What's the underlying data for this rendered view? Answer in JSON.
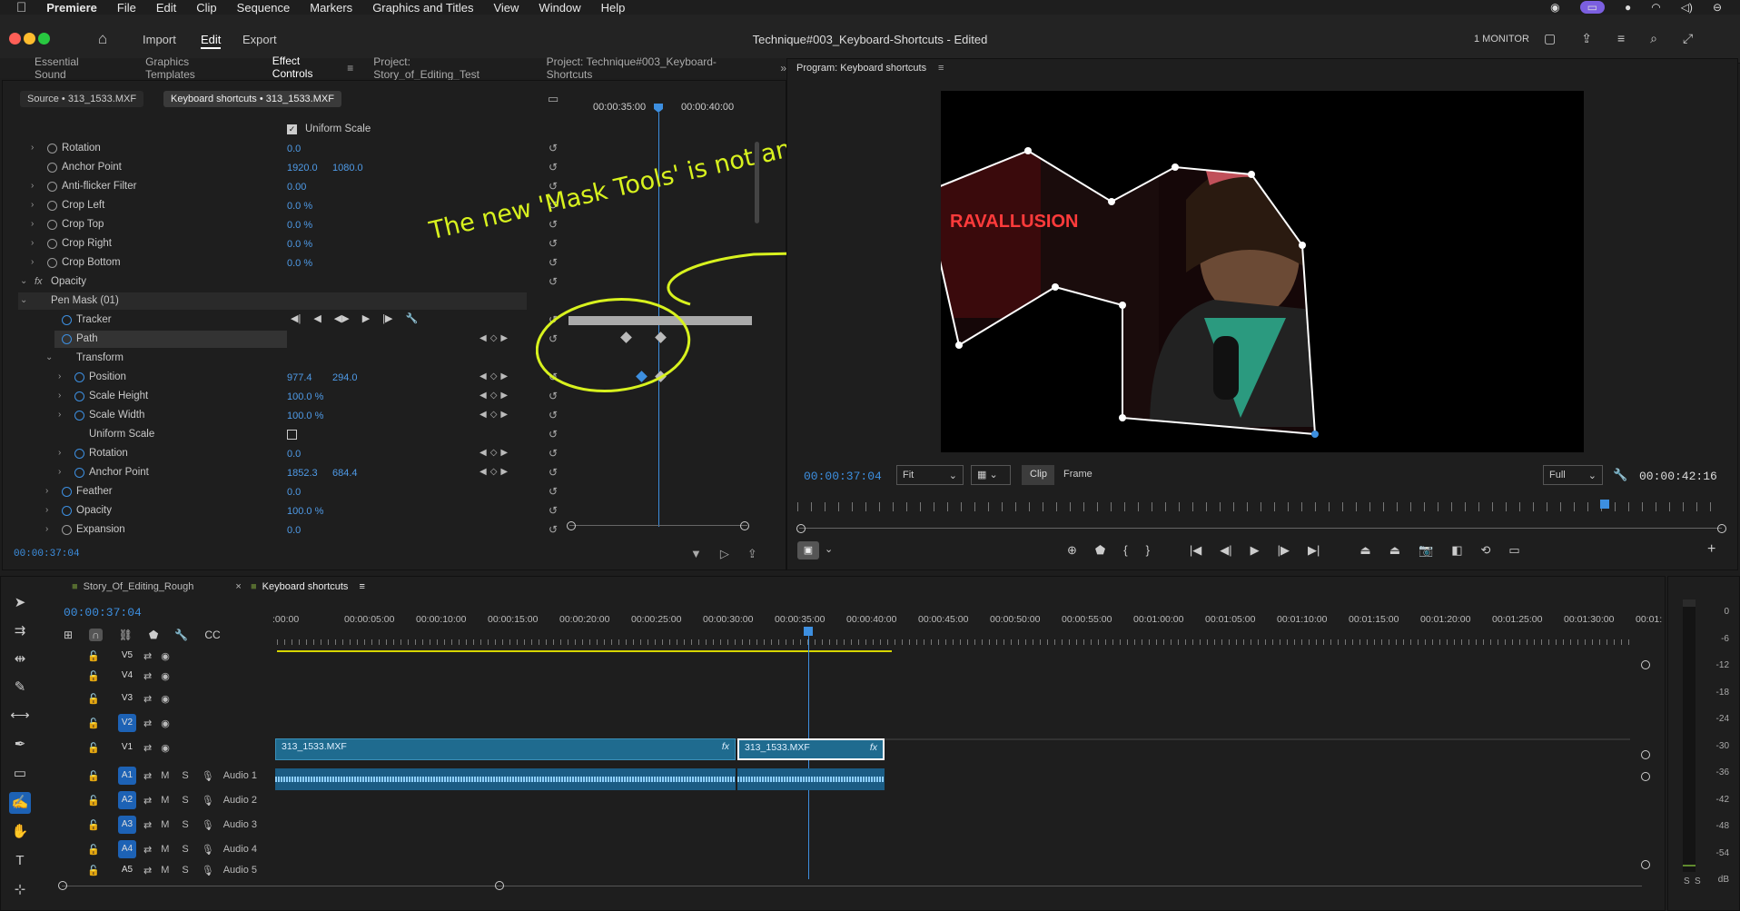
{
  "menu": {
    "apple": "",
    "app": "Premiere",
    "items": [
      "File",
      "Edit",
      "Clip",
      "Sequence",
      "Markers",
      "Graphics and Titles",
      "View",
      "Window",
      "Help"
    ]
  },
  "appbar": {
    "title": "Technique#003_Keyboard-Shortcuts - Edited",
    "nav": [
      "Import",
      "Edit",
      "Export"
    ],
    "monitor": "1 MONITOR"
  },
  "workspace_tabs": [
    "Essential Sound",
    "Graphics Templates",
    "Effect Controls",
    "Project: Story_of_Editing_Test",
    "Project: Technique#003_Keyboard-Shortcuts"
  ],
  "program_title": "Program: Keyboard shortcuts",
  "ec": {
    "source_tab": "Source • 313_1533.MXF",
    "seq_tab": "Keyboard shortcuts • 313_1533.MXF",
    "ruler": [
      "00:00:35:00",
      "00:00:40:00"
    ],
    "timecode": "00:00:37:04",
    "rows": [
      {
        "label": "Uniform Scale",
        "v1": "",
        "v2": ""
      },
      {
        "label": "Rotation",
        "v1": "0.0",
        "v2": ""
      },
      {
        "label": "Anchor Point",
        "v1": "1920.0",
        "v2": "1080.0"
      },
      {
        "label": "Anti-flicker Filter",
        "v1": "0.00",
        "v2": ""
      },
      {
        "label": "Crop Left",
        "v1": "0.0 %",
        "v2": ""
      },
      {
        "label": "Crop Top",
        "v1": "0.0 %",
        "v2": ""
      },
      {
        "label": "Crop Right",
        "v1": "0.0 %",
        "v2": ""
      },
      {
        "label": "Crop Bottom",
        "v1": "0.0 %",
        "v2": ""
      },
      {
        "label": "Opacity",
        "v1": "",
        "v2": ""
      },
      {
        "label": "Pen Mask (01)",
        "v1": "",
        "v2": ""
      },
      {
        "label": "Tracker",
        "v1": "",
        "v2": ""
      },
      {
        "label": "Path",
        "v1": "",
        "v2": ""
      },
      {
        "label": "Transform",
        "v1": "",
        "v2": ""
      },
      {
        "label": "Position",
        "v1": "977.4",
        "v2": "294.0"
      },
      {
        "label": "Scale Height",
        "v1": "100.0 %",
        "v2": ""
      },
      {
        "label": "Scale Width",
        "v1": "100.0 %",
        "v2": ""
      },
      {
        "label": "Uniform Scale",
        "v1": "",
        "v2": ""
      },
      {
        "label": "Rotation",
        "v1": "0.0",
        "v2": ""
      },
      {
        "label": "Anchor Point",
        "v1": "1852.3",
        "v2": "684.4"
      },
      {
        "label": "Feather",
        "v1": "0.0",
        "v2": ""
      },
      {
        "label": "Opacity",
        "v1": "100.0 %",
        "v2": ""
      },
      {
        "label": "Expansion",
        "v1": "0.0",
        "v2": ""
      }
    ]
  },
  "annotation": "The new 'Mask Tools' is not animateable",
  "program": {
    "timecode": "00:00:37:04",
    "fit": "Fit",
    "clip": "Clip",
    "frame": "Frame",
    "full": "Full",
    "duration": "00:00:42:16",
    "sign": "RAVALLUSION"
  },
  "timeline": {
    "tabs": [
      "Story_Of_Editing_Rough",
      "Keyboard shortcuts"
    ],
    "timecode": "00:00:37:04",
    "ruler": [
      ":00:00",
      "00:00:05:00",
      "00:00:10:00",
      "00:00:15:00",
      "00:00:20:00",
      "00:00:25:00",
      "00:00:30:00",
      "00:00:35:00",
      "00:00:40:00",
      "00:00:45:00",
      "00:00:50:00",
      "00:00:55:00",
      "00:01:00:00",
      "00:01:05:00",
      "00:01:10:00",
      "00:01:15:00",
      "00:01:20:00",
      "00:01:25:00",
      "00:01:30:00",
      "00:01:"
    ],
    "video_tracks": [
      "V5",
      "V4",
      "V3",
      "V2",
      "V1"
    ],
    "audio_tracks": [
      {
        "id": "A1",
        "name": "Audio 1"
      },
      {
        "id": "A2",
        "name": "Audio 2"
      },
      {
        "id": "A3",
        "name": "Audio 3"
      },
      {
        "id": "A4",
        "name": "Audio 4"
      },
      {
        "id": "A5",
        "name": "Audio 5"
      }
    ],
    "clip1": "313_1533.MXF",
    "clip2": "313_1533.MXF",
    "fx": "fx",
    "m": "M",
    "s": "S"
  },
  "meter": {
    "labels": [
      "0",
      "-6",
      "-12",
      "-18",
      "-24",
      "-30",
      "-36",
      "-42",
      "-48",
      "-54",
      "dB"
    ],
    "bottom": [
      "S",
      "S"
    ]
  },
  "colors": {
    "accent": "#3d8fe0",
    "annotation": "#d8f21e",
    "clip": "#1f6b8f"
  }
}
